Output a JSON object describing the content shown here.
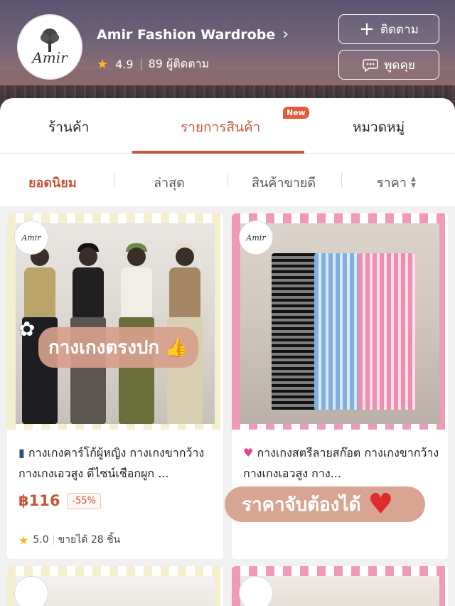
{
  "shop": {
    "name": "Amir Fashion Wardrobe",
    "chevron": "›",
    "rating": "4.9",
    "followers": "89 ผู้ติดตาม",
    "logo_text": "Amir",
    "follow_label": "ติดตาม",
    "chat_label": "พูดคุย"
  },
  "tabs": [
    {
      "label": "ร้านค้า",
      "active": false
    },
    {
      "label": "รายการสินค้า",
      "active": true,
      "badge": "New"
    },
    {
      "label": "หมวดหมู่",
      "active": false
    }
  ],
  "sort": [
    {
      "label": "ยอดนิยม",
      "active": true
    },
    {
      "label": "ล่าสุด",
      "active": false
    },
    {
      "label": "สินค้าขายดี",
      "active": false
    },
    {
      "label": "ราคา",
      "active": false
    }
  ],
  "products": [
    {
      "title": "กางเกงคาร์โก้ผู้หญิง กางเกงขากว้าง กางเกงเอวสูง ดีไซน์เชือกผูก ...",
      "image_overlay": "กางเกงตรงปก",
      "logo_text": "Amir",
      "price": "฿116",
      "discount": "-55%",
      "rating": "5.0",
      "sold": "ขายได้ 28 ชิ้น"
    },
    {
      "title": "กางเกงสตรีลายสก๊อต กางเกงขากว้าง กางเกงเอวสูง กาง...",
      "logo_text": "Amir",
      "promo": "ราคาจับต้องได้"
    }
  ],
  "colors": {
    "accent": "#c6563a",
    "badge": "#e25b3b",
    "star": "#f7b924"
  }
}
